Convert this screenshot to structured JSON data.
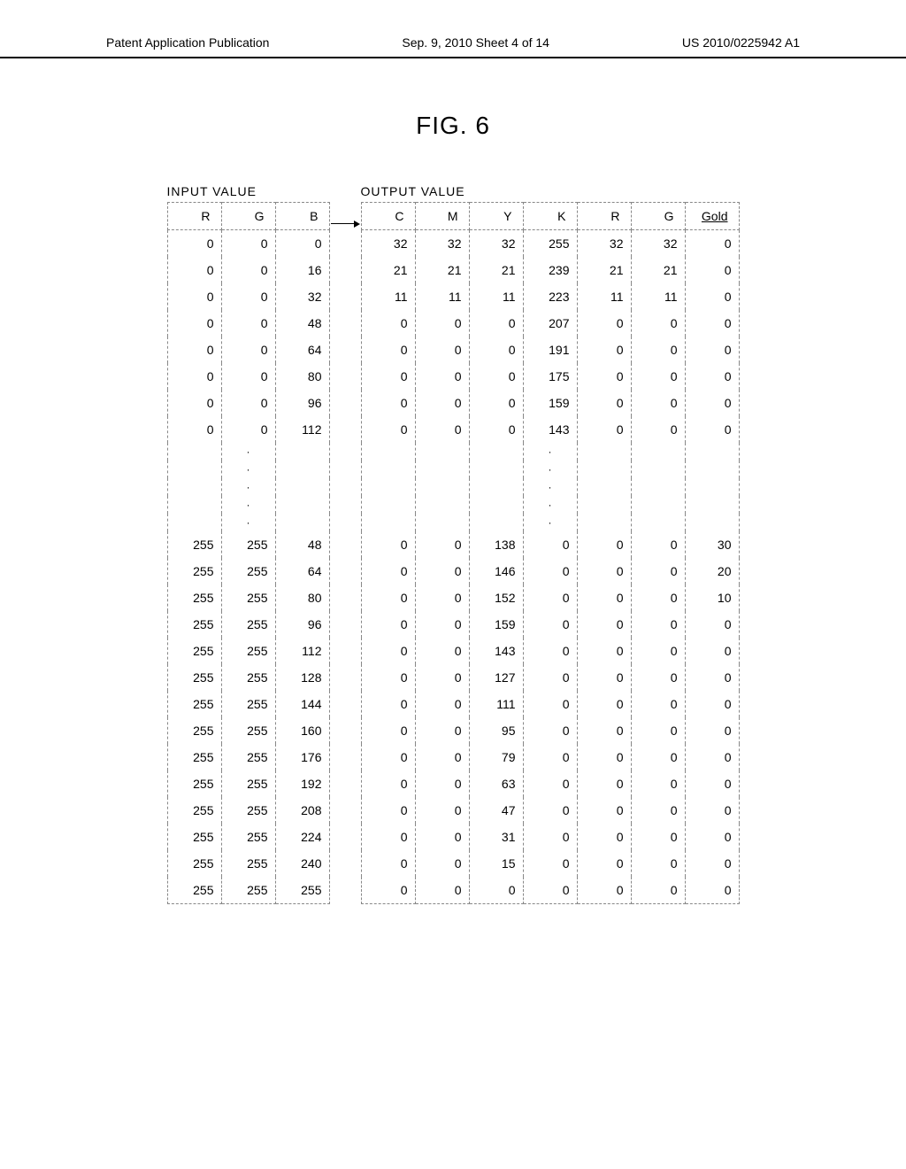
{
  "header": {
    "left": "Patent Application Publication",
    "center": "Sep. 9, 2010  Sheet 4 of 14",
    "right": "US 2010/0225942 A1"
  },
  "figure_title": "FIG. 6",
  "input_table": {
    "label": "INPUT VALUE",
    "headers": [
      "R",
      "G",
      "B"
    ],
    "block1": [
      [
        0,
        0,
        0
      ],
      [
        0,
        0,
        16
      ],
      [
        0,
        0,
        32
      ],
      [
        0,
        0,
        48
      ],
      [
        0,
        0,
        64
      ],
      [
        0,
        0,
        80
      ],
      [
        0,
        0,
        96
      ],
      [
        0,
        0,
        112
      ]
    ],
    "block2": [
      [
        255,
        255,
        48
      ],
      [
        255,
        255,
        64
      ],
      [
        255,
        255,
        80
      ],
      [
        255,
        255,
        96
      ],
      [
        255,
        255,
        112
      ],
      [
        255,
        255,
        128
      ],
      [
        255,
        255,
        144
      ],
      [
        255,
        255,
        160
      ],
      [
        255,
        255,
        176
      ],
      [
        255,
        255,
        192
      ],
      [
        255,
        255,
        208
      ],
      [
        255,
        255,
        224
      ],
      [
        255,
        255,
        240
      ],
      [
        255,
        255,
        255
      ]
    ]
  },
  "output_table": {
    "label": "OUTPUT VALUE",
    "headers": [
      "C",
      "M",
      "Y",
      "K",
      "R",
      "G",
      "Gold"
    ],
    "block1": [
      [
        32,
        32,
        32,
        255,
        32,
        32,
        0
      ],
      [
        21,
        21,
        21,
        239,
        21,
        21,
        0
      ],
      [
        11,
        11,
        11,
        223,
        11,
        11,
        0
      ],
      [
        0,
        0,
        0,
        207,
        0,
        0,
        0
      ],
      [
        0,
        0,
        0,
        191,
        0,
        0,
        0
      ],
      [
        0,
        0,
        0,
        175,
        0,
        0,
        0
      ],
      [
        0,
        0,
        0,
        159,
        0,
        0,
        0
      ],
      [
        0,
        0,
        0,
        143,
        0,
        0,
        0
      ]
    ],
    "block2": [
      [
        0,
        0,
        138,
        0,
        0,
        0,
        30
      ],
      [
        0,
        0,
        146,
        0,
        0,
        0,
        20
      ],
      [
        0,
        0,
        152,
        0,
        0,
        0,
        10
      ],
      [
        0,
        0,
        159,
        0,
        0,
        0,
        0
      ],
      [
        0,
        0,
        143,
        0,
        0,
        0,
        0
      ],
      [
        0,
        0,
        127,
        0,
        0,
        0,
        0
      ],
      [
        0,
        0,
        111,
        0,
        0,
        0,
        0
      ],
      [
        0,
        0,
        95,
        0,
        0,
        0,
        0
      ],
      [
        0,
        0,
        79,
        0,
        0,
        0,
        0
      ],
      [
        0,
        0,
        63,
        0,
        0,
        0,
        0
      ],
      [
        0,
        0,
        47,
        0,
        0,
        0,
        0
      ],
      [
        0,
        0,
        31,
        0,
        0,
        0,
        0
      ],
      [
        0,
        0,
        15,
        0,
        0,
        0,
        0
      ],
      [
        0,
        0,
        0,
        0,
        0,
        0,
        0
      ]
    ]
  },
  "ellipsis": "·"
}
